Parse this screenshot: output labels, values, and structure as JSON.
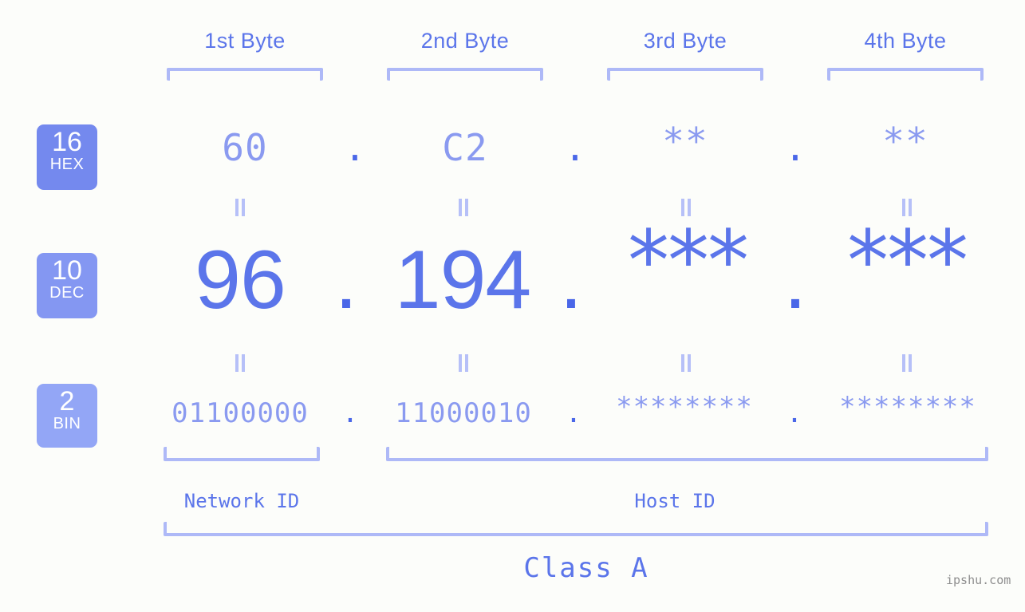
{
  "background_color": "#fcfdfa",
  "accent_color": "#5b75ea",
  "muted_accent_color": "#8a9af0",
  "bracket_color": "#aeb9f7",
  "headers": {
    "byte1": "1st Byte",
    "byte2": "2nd Byte",
    "byte3": "3rd Byte",
    "byte4": "4th Byte"
  },
  "bases": [
    {
      "num": "16",
      "abbr": "HEX",
      "color": "#7489ee"
    },
    {
      "num": "10",
      "abbr": "DEC",
      "color": "#8497f2"
    },
    {
      "num": "2",
      "abbr": "BIN",
      "color": "#93a6f6"
    }
  ],
  "rows": {
    "hex": {
      "label_num": "16",
      "label_abbr": "HEX",
      "values": [
        "60",
        "C2",
        "**",
        "**"
      ],
      "separator": "."
    },
    "dec": {
      "label_num": "10",
      "label_abbr": "DEC",
      "values": [
        "96",
        "194",
        "***",
        "***"
      ],
      "separator": "."
    },
    "bin": {
      "label_num": "2",
      "label_abbr": "BIN",
      "values": [
        "01100000",
        "11000010",
        "********",
        "********"
      ],
      "separator": "."
    }
  },
  "equals_marks": {
    "glyph": "=",
    "count_per_row": 4,
    "rows": 2
  },
  "segments": {
    "network_id": "Network ID",
    "host_id": "Host ID",
    "class": "Class A"
  },
  "watermark": "ipshu.com"
}
